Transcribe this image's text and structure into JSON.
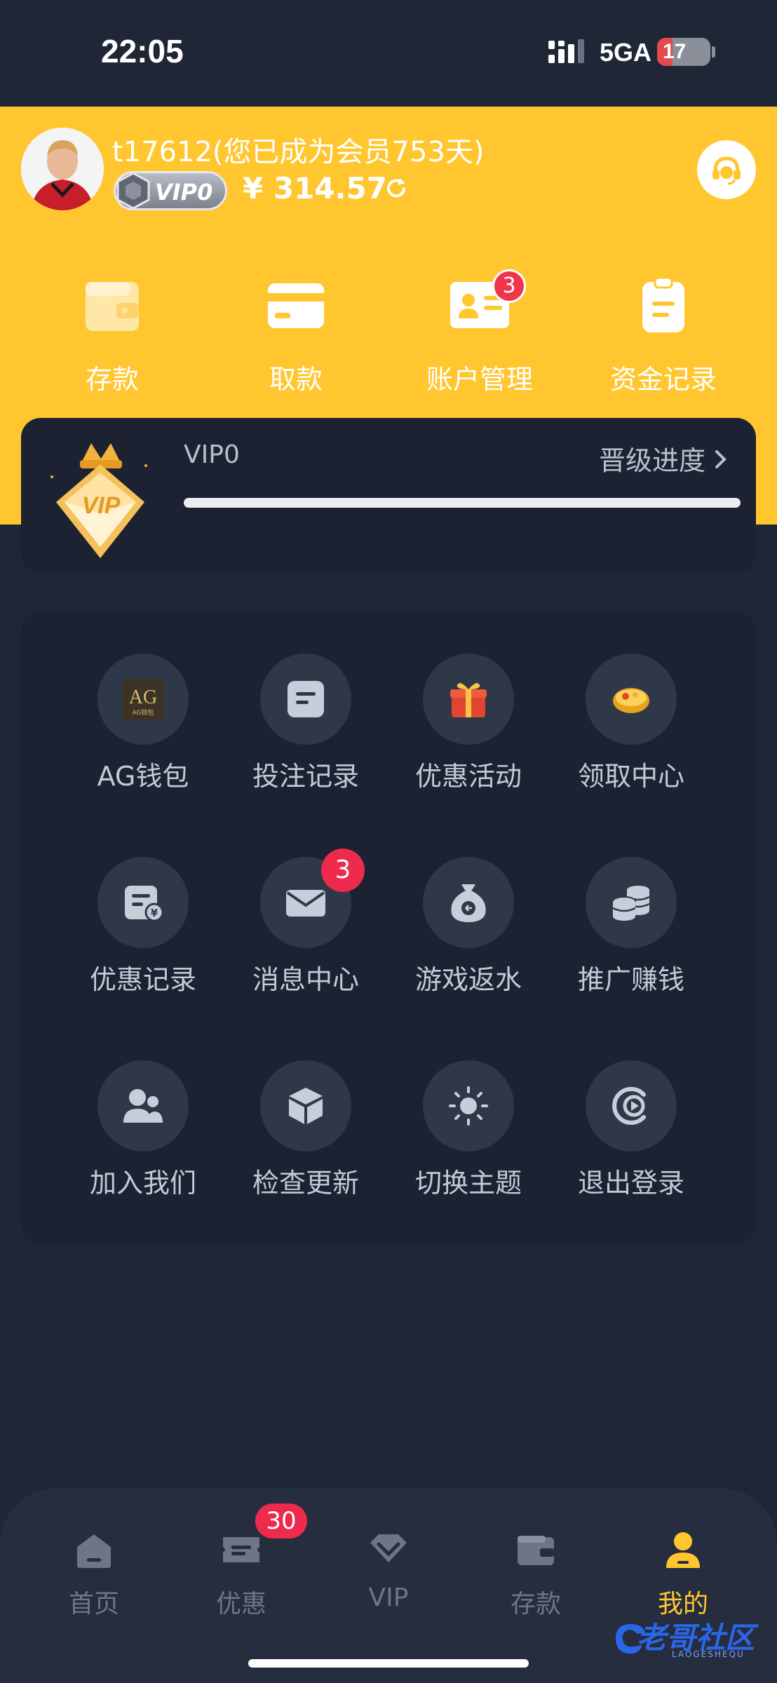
{
  "status_bar": {
    "time": "22:05",
    "network": "5GA",
    "battery": "17"
  },
  "header": {
    "username": "t17612(您已成为会员753天)",
    "vip_badge": "VIP0",
    "balance": "¥ 314.57",
    "quick_actions": [
      {
        "label": "存款",
        "icon": "wallet-icon"
      },
      {
        "label": "取款",
        "icon": "card-icon"
      },
      {
        "label": "账户管理",
        "icon": "id-card-icon",
        "badge": "3"
      },
      {
        "label": "资金记录",
        "icon": "clipboard-icon"
      }
    ]
  },
  "vip_card": {
    "level": "VIP0",
    "upgrade_label": "晋级进度",
    "progress": 0
  },
  "menu": {
    "items": [
      {
        "label": "AG钱包",
        "icon": "ag-wallet-icon",
        "icon_text": "AG钱包"
      },
      {
        "label": "投注记录",
        "icon": "bet-record-icon"
      },
      {
        "label": "优惠活动",
        "icon": "gift-icon"
      },
      {
        "label": "领取中心",
        "icon": "coin-bowl-icon"
      },
      {
        "label": "优惠记录",
        "icon": "promo-record-icon"
      },
      {
        "label": "消息中心",
        "icon": "mail-icon",
        "badge": "3"
      },
      {
        "label": "游戏返水",
        "icon": "money-bag-icon"
      },
      {
        "label": "推广赚钱",
        "icon": "coin-stack-icon"
      },
      {
        "label": "加入我们",
        "icon": "users-icon"
      },
      {
        "label": "检查更新",
        "icon": "cube-icon"
      },
      {
        "label": "切换主题",
        "icon": "sun-icon"
      },
      {
        "label": "退出登录",
        "icon": "logout-icon"
      }
    ]
  },
  "tab_bar": {
    "tabs": [
      {
        "label": "首页",
        "icon": "home-icon"
      },
      {
        "label": "优惠",
        "icon": "ticket-icon",
        "badge": "30"
      },
      {
        "label": "VIP",
        "icon": "diamond-icon"
      },
      {
        "label": "存款",
        "icon": "wallet-icon"
      },
      {
        "label": "我的",
        "icon": "person-icon",
        "active": true
      }
    ]
  },
  "watermark": {
    "text": "老哥社区",
    "sub": "LAOGESHEQU"
  },
  "colors": {
    "accent": "#ffc630",
    "background": "#1f2636",
    "card": "#1c2231",
    "badge": "#ee2a4d"
  }
}
